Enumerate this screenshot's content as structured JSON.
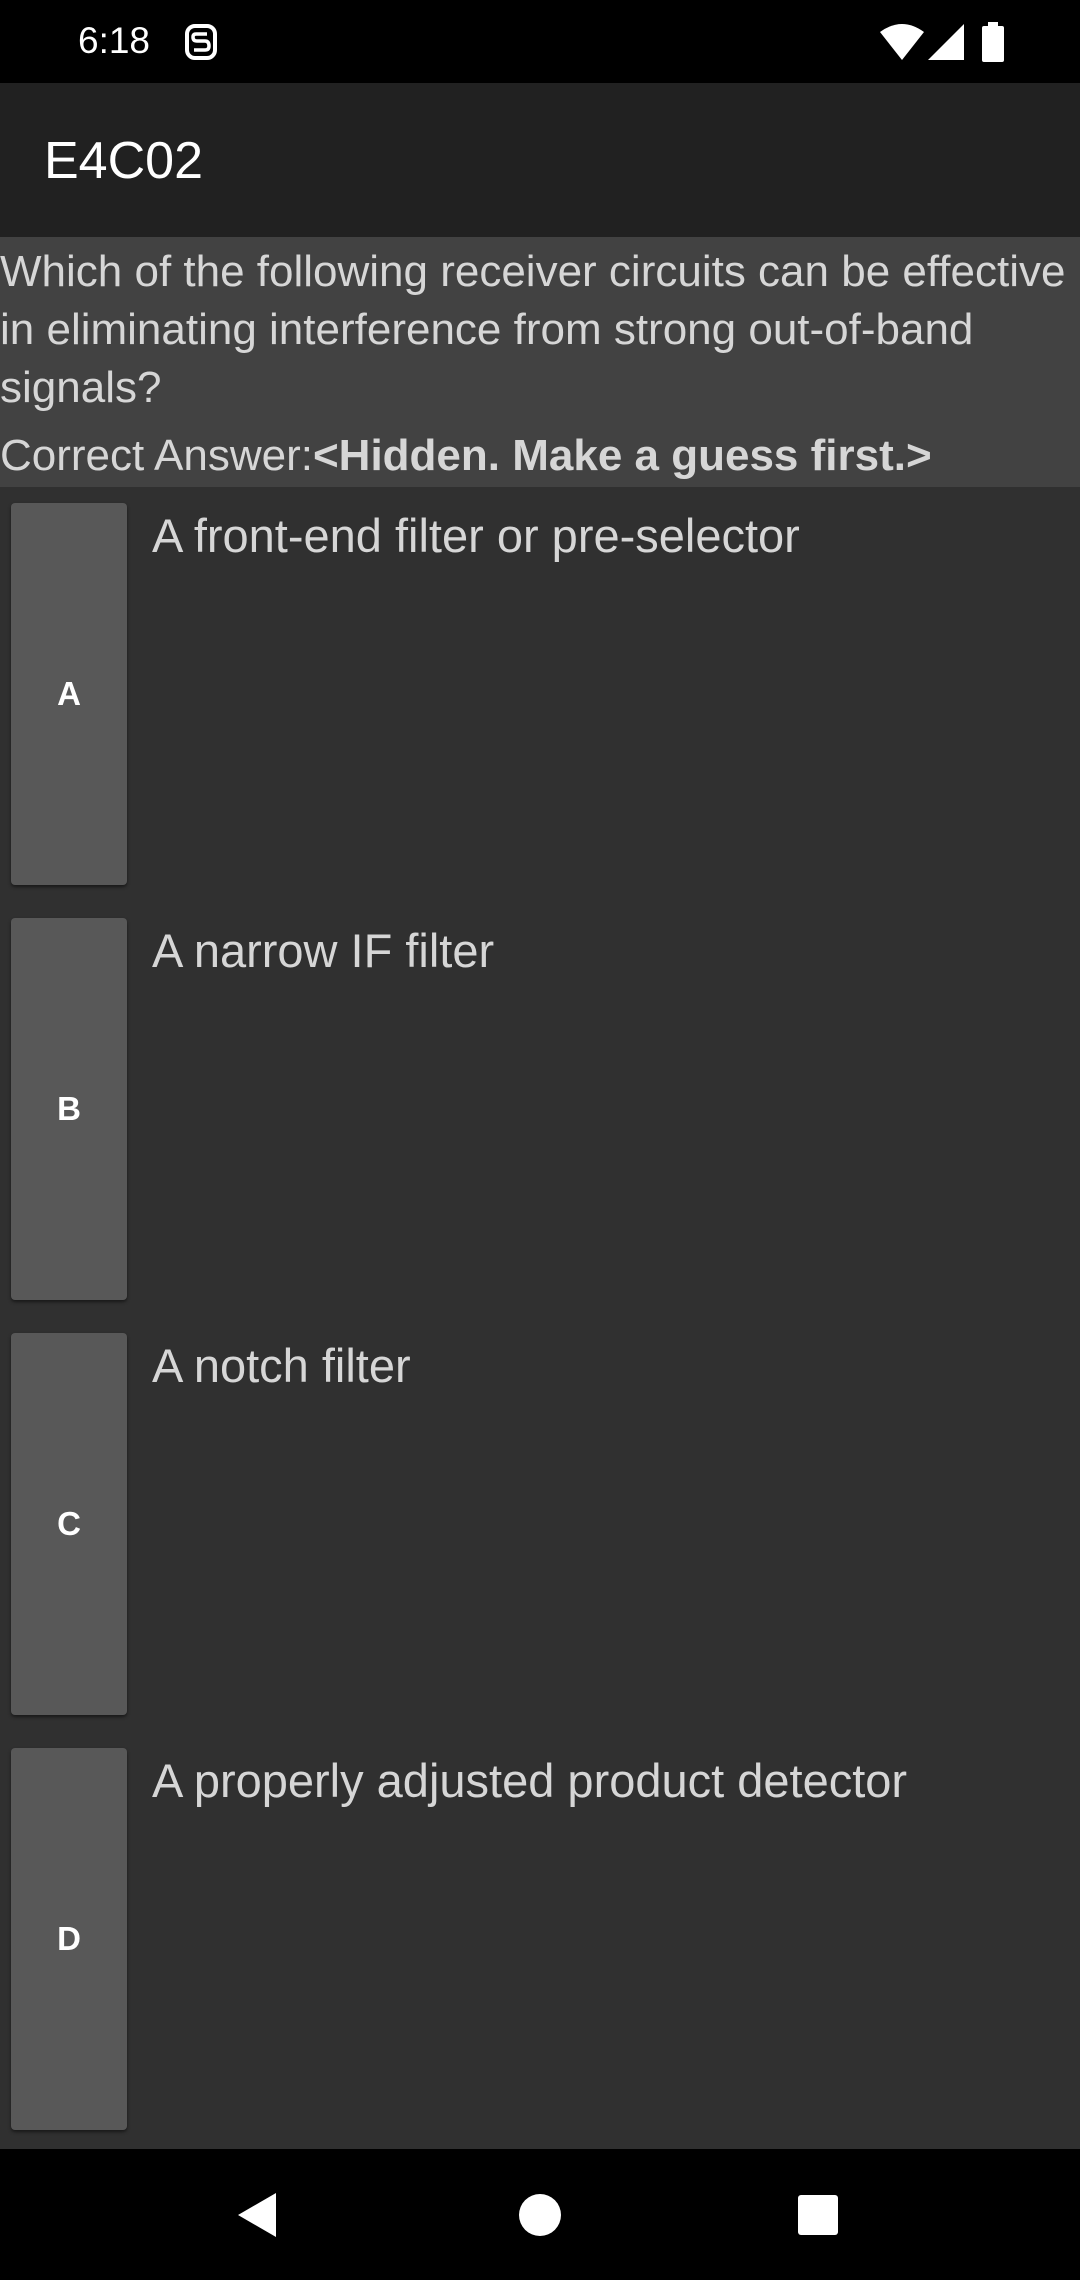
{
  "status_bar": {
    "time": "6:18",
    "icons": [
      "notification-s-icon",
      "wifi-icon",
      "cellular-signal-icon",
      "battery-icon"
    ]
  },
  "app_bar": {
    "title": "E4C02"
  },
  "question": {
    "text": "Which of the following receiver circuits can be effective in eliminating interference from strong out-of-band signals?",
    "answer_label": "Correct Answer:",
    "answer_value": "<Hidden. Make a guess first.>"
  },
  "options": [
    {
      "letter": "A",
      "text": "A front-end filter or pre-selector"
    },
    {
      "letter": "B",
      "text": "A narrow IF filter"
    },
    {
      "letter": "C",
      "text": "A notch filter"
    },
    {
      "letter": "D",
      "text": "A properly adjusted product detector"
    }
  ],
  "nav_bar": {
    "icons": [
      "back-icon",
      "home-icon",
      "recents-icon"
    ]
  },
  "colors": {
    "status_bar": "#000000",
    "app_bar": "#212121",
    "background": "#303030",
    "question_bg": "#424242",
    "option_button": "#585858",
    "text": "#d6d6d6"
  }
}
